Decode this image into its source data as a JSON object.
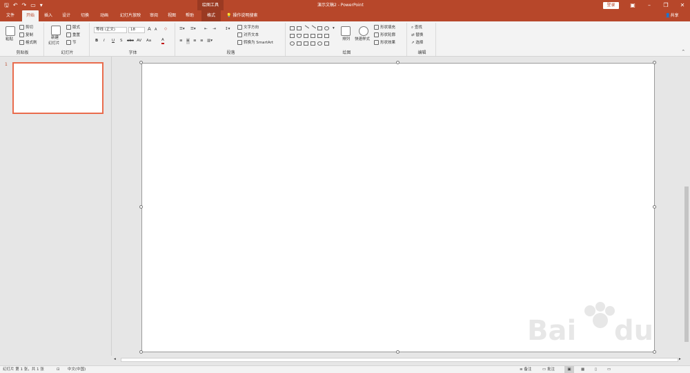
{
  "app": {
    "document_title": "演示文稿2  -  PowerPoint",
    "context_tool": "绘图工具",
    "login_label": "登录",
    "share_label": "共享"
  },
  "tabs": [
    {
      "label": "文件"
    },
    {
      "label": "开始"
    },
    {
      "label": "插入"
    },
    {
      "label": "设计"
    },
    {
      "label": "切换"
    },
    {
      "label": "动画"
    },
    {
      "label": "幻灯片放映"
    },
    {
      "label": "审阅"
    },
    {
      "label": "视图"
    },
    {
      "label": "帮助"
    },
    {
      "label": "格式"
    }
  ],
  "tell_me": "操作说明搜索",
  "ribbon": {
    "clipboard": {
      "paste": "粘贴",
      "cut": "剪切",
      "copy": "复制",
      "format_painter": "格式刷",
      "label": "剪贴板"
    },
    "slides": {
      "new_slide_1": "新建",
      "new_slide_2": "幻灯片",
      "layout": "版式",
      "reset": "重置",
      "section": "节",
      "label": "幻灯片"
    },
    "font": {
      "font_name": "等线 (正文)",
      "font_size": "18",
      "bold": "B",
      "italic": "I",
      "underline": "U",
      "shadow": "S",
      "strike": "abc",
      "spacing": "AV",
      "case": "Aa",
      "grow": "A",
      "shrink": "A",
      "label": "字体"
    },
    "paragraph": {
      "text_direction": "文字方向",
      "align_text": "对齐文本",
      "smartart": "转换为 SmartArt",
      "label": "段落"
    },
    "drawing": {
      "arrange": "排列",
      "quick_styles": "快速样式",
      "shape_fill": "形状填充",
      "shape_outline": "形状轮廓",
      "shape_effects": "形状效果",
      "label": "绘图"
    },
    "editing": {
      "find": "查找",
      "replace": "替换",
      "select": "选择",
      "label": "编辑"
    }
  },
  "slides_pane": {
    "slide_number": "1"
  },
  "status": {
    "slide_info": "幻灯片 第 1 张，共 1 张",
    "language": "中文(中国)",
    "notes": "备注",
    "comments": "批注"
  },
  "colors": {
    "accent": "#b7472a",
    "thumb_border": "#e96b4c"
  }
}
